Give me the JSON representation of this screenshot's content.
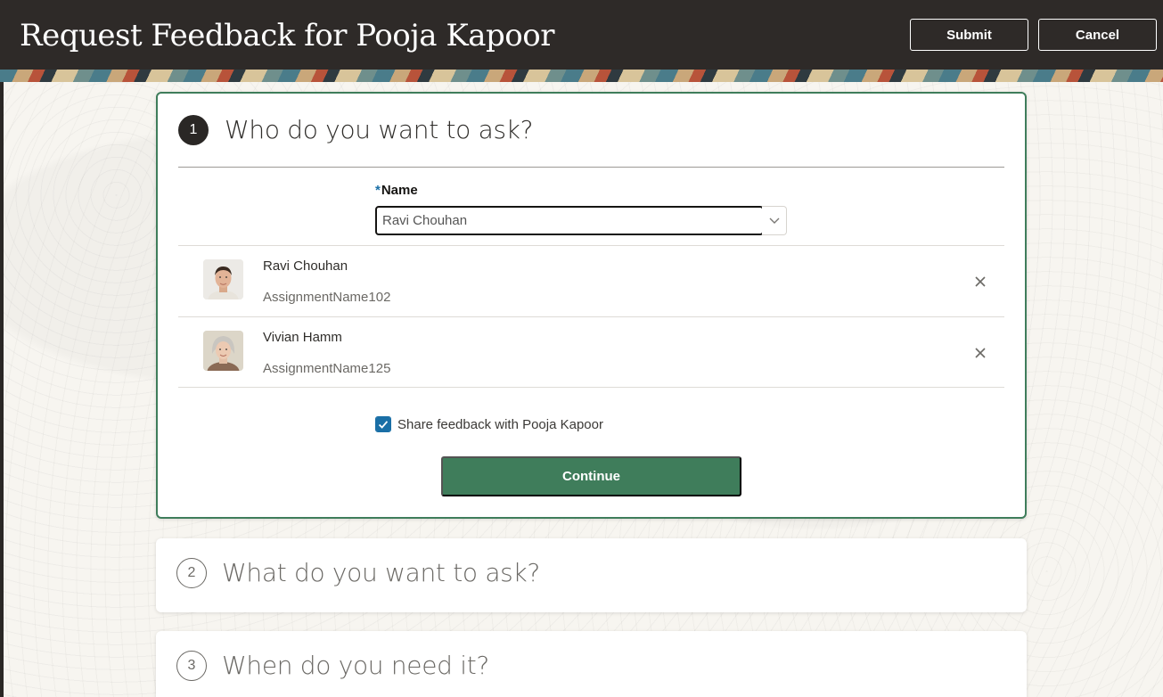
{
  "header": {
    "title": "Request Feedback for Pooja Kapoor",
    "submit_label": "Submit",
    "cancel_label": "Cancel"
  },
  "step1": {
    "number": "1",
    "title": "Who do you want to ask?",
    "name_label": "Name",
    "required_mark": "*",
    "name_value": "Ravi Chouhan",
    "people": [
      {
        "name": "Ravi Chouhan",
        "assignment": "AssignmentName102",
        "avatar": "man-photo"
      },
      {
        "name": "Vivian Hamm",
        "assignment": "AssignmentName125",
        "avatar": "woman-photo"
      }
    ],
    "share_label": "Share feedback with Pooja Kapoor",
    "share_checked": true,
    "continue_label": "Continue"
  },
  "step2": {
    "number": "2",
    "title": "What do you want to ask?"
  },
  "step3": {
    "number": "3",
    "title": "When do you need it?"
  },
  "colors": {
    "header_bg": "#2e2a28",
    "accent_green": "#3f7d5b",
    "checkbox_blue": "#1a6fa6"
  }
}
